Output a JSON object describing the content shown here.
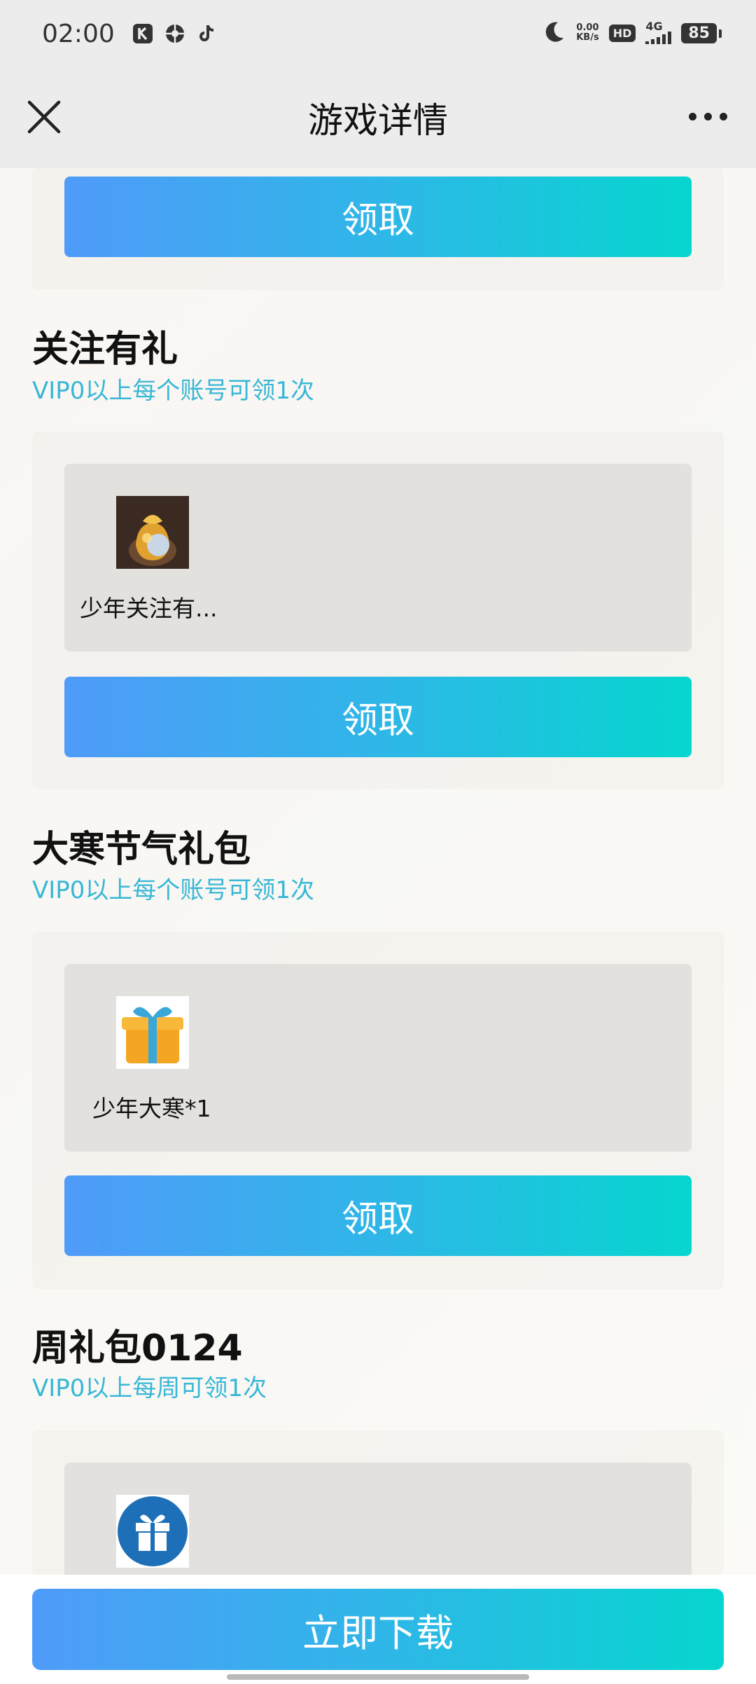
{
  "status_bar": {
    "time": "02:00",
    "net_speed_value": "0.00",
    "net_speed_unit": "KB/s",
    "hd": "HD",
    "network": "4G",
    "battery": "85"
  },
  "nav": {
    "title": "游戏详情"
  },
  "top_card": {
    "claim_label": "领取"
  },
  "sections": [
    {
      "title": "关注有礼",
      "subtitle": "VIP0以上每个账号可领1次",
      "item_label": "少年关注有...",
      "claim_label": "领取"
    },
    {
      "title": "大寒节气礼包",
      "subtitle": "VIP0以上每个账号可领1次",
      "item_label": "少年大寒*1",
      "claim_label": "领取"
    },
    {
      "title": "周礼包0124",
      "subtitle": "VIP0以上每周可领1次"
    }
  ],
  "bottom": {
    "download_label": "立即下载"
  },
  "colors": {
    "accent_start": "#4f9bf9",
    "accent_end": "#06d6cf",
    "subtitle": "#38b7d6"
  }
}
